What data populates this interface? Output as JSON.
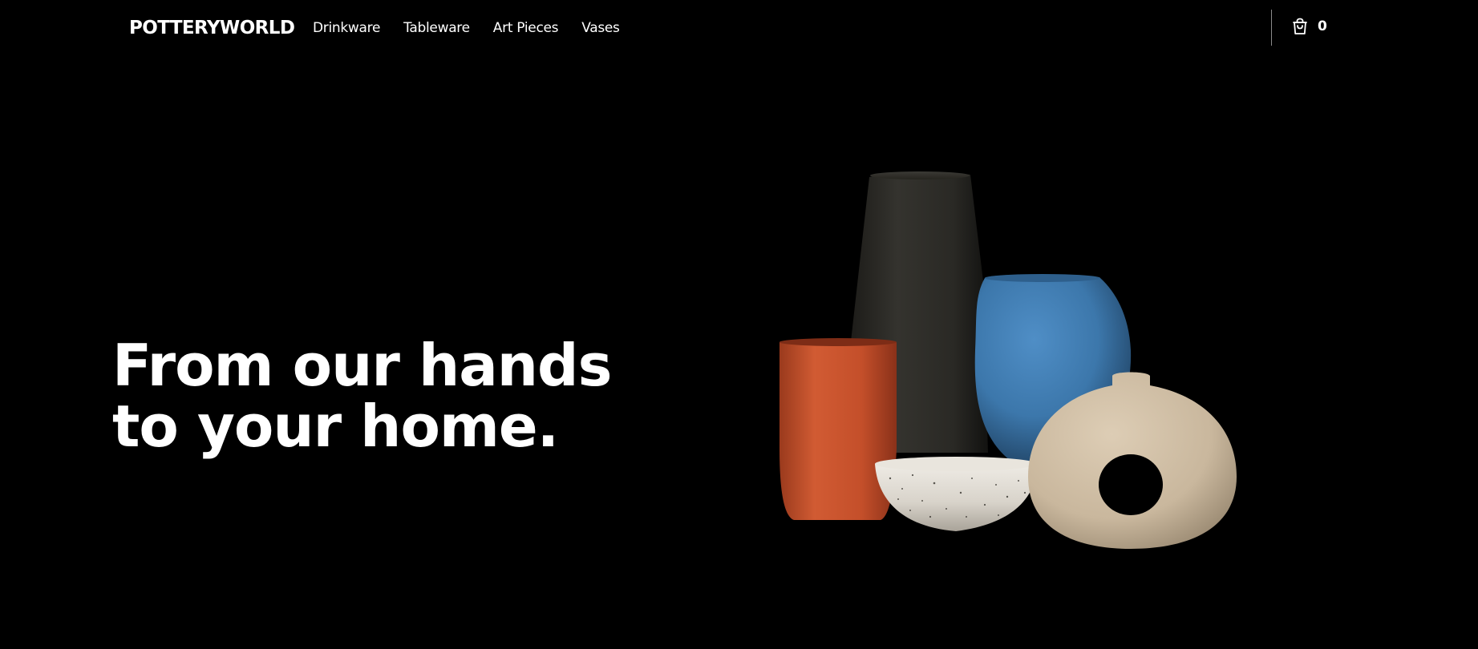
{
  "brand": {
    "name": "POTTERYWORLD"
  },
  "nav": {
    "links": [
      {
        "label": "Drinkware"
      },
      {
        "label": "Tableware"
      },
      {
        "label": "Art Pieces"
      },
      {
        "label": "Vases"
      }
    ]
  },
  "cart": {
    "icon": "shopping-bag-icon",
    "count": "0"
  },
  "hero": {
    "title_line1": "From our hands",
    "title_line2": "to your home."
  },
  "colors": {
    "background": "#000000",
    "text": "#ffffff",
    "vase_black": "#2b2a26",
    "cup_orange": "#c9532f",
    "vase_blue": "#3f7ab0",
    "bowl_white": "#dedad2",
    "donut_vase": "#cbb9a0"
  }
}
